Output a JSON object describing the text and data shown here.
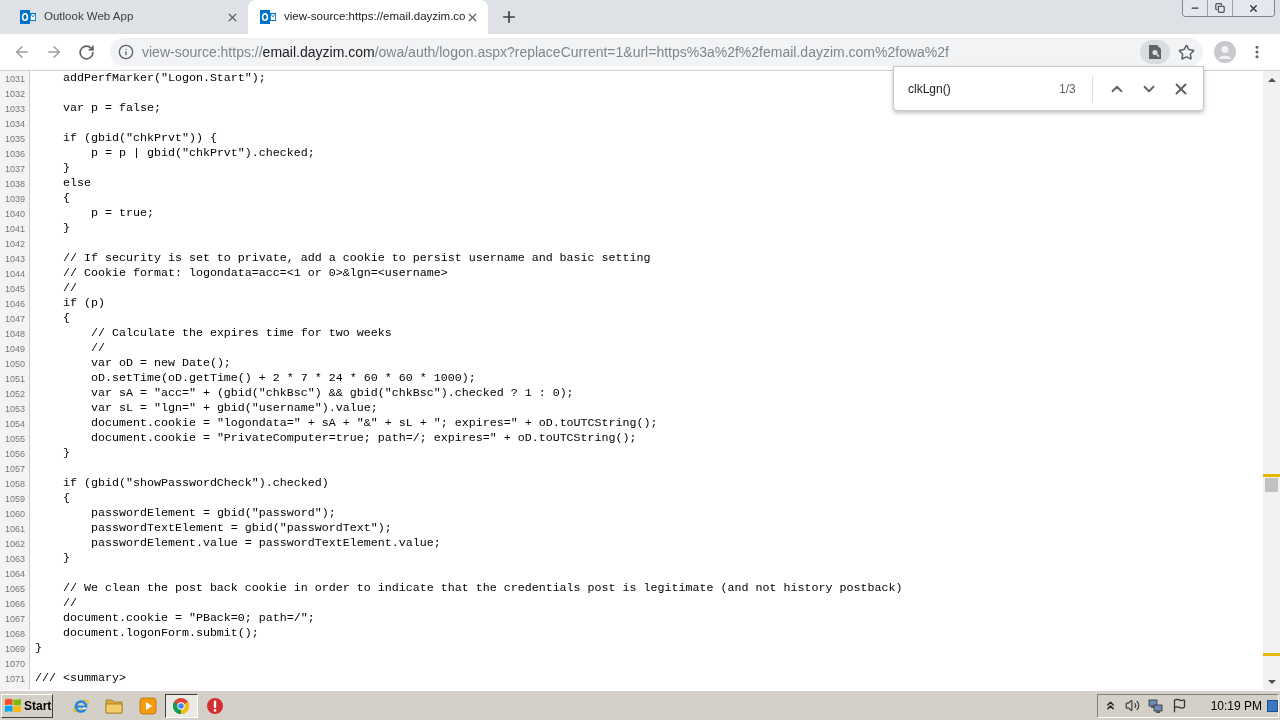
{
  "browser": {
    "tabs": [
      {
        "title": "Outlook Web App",
        "selected": false
      },
      {
        "title": "view-source:https://email.dayzim.co",
        "selected": true
      }
    ],
    "address_bar": {
      "scheme": "view-source:https://",
      "host": "email.dayzim.com",
      "path": "/owa/auth/logon.aspx?replaceCurrent=1&url=https%3a%2f%2femail.dayzim.com%2fowa%2f"
    }
  },
  "find_bar": {
    "value": "clkLgn()",
    "count": "1/3"
  },
  "source": {
    "lines": [
      {
        "number": "1031",
        "code": "    addPerfMarker(\"Logon.Start\");"
      },
      {
        "number": "1032"
      },
      {
        "number": "1033",
        "code": "    var p = false;"
      },
      {
        "number": "1034"
      },
      {
        "number": "1035",
        "code": "    if (gbid(\"chkPrvt\")) {"
      },
      {
        "number": "1036",
        "code": "        p = p | gbid(\"chkPrvt\").checked;"
      },
      {
        "number": "1037",
        "code": "    }"
      },
      {
        "number": "1038",
        "code": "    else"
      },
      {
        "number": "1039",
        "code": "    {"
      },
      {
        "number": "1040",
        "code": "        p = true;"
      },
      {
        "number": "1041",
        "code": "    }"
      },
      {
        "number": "1042"
      },
      {
        "number": "1043",
        "code": "    // If security is set to private, add a cookie to persist username and basic setting"
      },
      {
        "number": "1044",
        "code": "    // Cookie format: logondata=acc=<1 or 0>&lgn=<username>"
      },
      {
        "number": "1045",
        "code": "    //"
      },
      {
        "number": "1046",
        "code": "    if (p)"
      },
      {
        "number": "1047",
        "code": "    {"
      },
      {
        "number": "1048",
        "code": "        // Calculate the expires time for two weeks"
      },
      {
        "number": "1049",
        "code": "        //"
      },
      {
        "number": "1050",
        "code": "        var oD = new Date();"
      },
      {
        "number": "1051",
        "code": "        oD.setTime(oD.getTime() + 2 * 7 * 24 * 60 * 60 * 1000);"
      },
      {
        "number": "1052",
        "code": "        var sA = \"acc=\" + (gbid(\"chkBsc\") && gbid(\"chkBsc\").checked ? 1 : 0);"
      },
      {
        "number": "1053",
        "code": "        var sL = \"lgn=\" + gbid(\"username\").value;"
      },
      {
        "number": "1054",
        "code": "        document.cookie = \"logondata=\" + sA + \"&\" + sL + \"; expires=\" + oD.toUTCString();"
      },
      {
        "number": "1055",
        "code": "        document.cookie = \"PrivateComputer=true; path=/; expires=\" + oD.toUTCString();"
      },
      {
        "number": "1056",
        "code": "    }"
      },
      {
        "number": "1057"
      },
      {
        "number": "1058",
        "code": "    if (gbid(\"showPasswordCheck\").checked)"
      },
      {
        "number": "1059",
        "code": "    {"
      },
      {
        "number": "1060",
        "code": "        passwordElement = gbid(\"password\");"
      },
      {
        "number": "1061",
        "code": "        passwordTextElement = gbid(\"passwordText\");"
      },
      {
        "number": "1062",
        "code": "        passwordElement.value = passwordTextElement.value;"
      },
      {
        "number": "1063",
        "code": "    }"
      },
      {
        "number": "1064"
      },
      {
        "number": "1065",
        "code": "    // We clean the post back cookie in order to indicate that the credentials post is legitimate (and not history postback)"
      },
      {
        "number": "1066",
        "code": "    //"
      },
      {
        "number": "1067",
        "code": "    document.cookie = \"PBack=0; path=/\";"
      },
      {
        "number": "1068",
        "code": "    document.logonForm.submit();"
      },
      {
        "number": "1069",
        "code": "}"
      },
      {
        "number": "1070"
      },
      {
        "number": "1071",
        "code": "/// <summary>"
      }
    ]
  },
  "taskbar": {
    "start": "Start",
    "apps": [
      {
        "kind": "ie",
        "selected": false
      },
      {
        "kind": "folder",
        "selected": false
      },
      {
        "kind": "media",
        "selected": false
      },
      {
        "kind": "chrome",
        "selected": true
      },
      {
        "kind": "alert",
        "selected": false
      }
    ],
    "clock": "10:19 PM"
  }
}
